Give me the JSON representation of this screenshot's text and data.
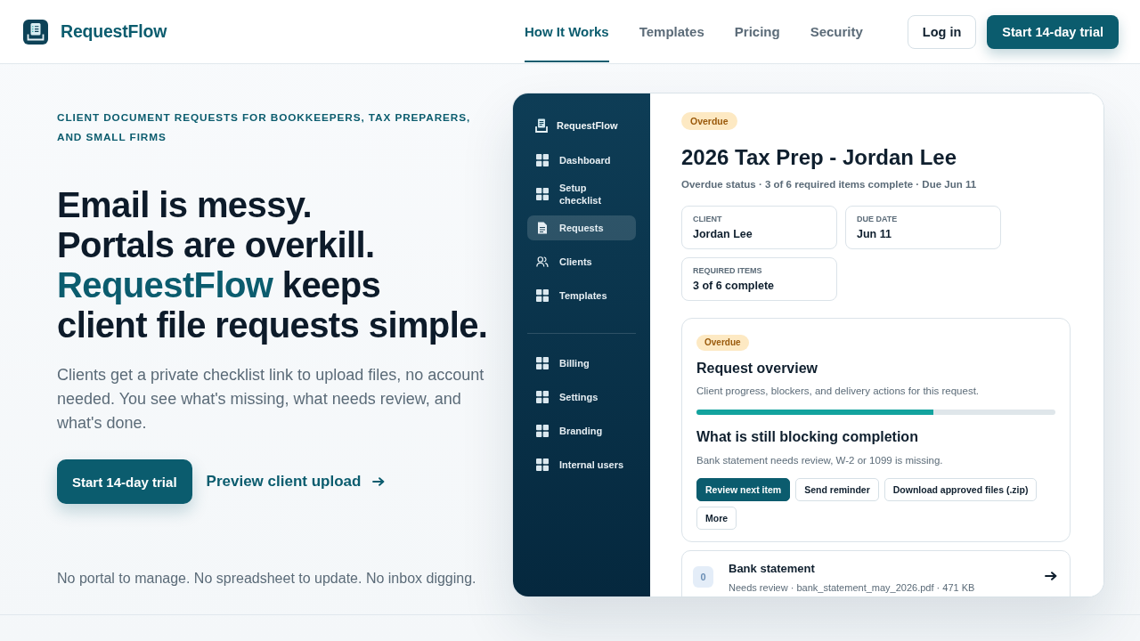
{
  "header": {
    "brand": "RequestFlow",
    "nav": [
      {
        "label": "How It Works",
        "selected": true
      },
      {
        "label": "Templates",
        "selected": false
      },
      {
        "label": "Pricing",
        "selected": false
      },
      {
        "label": "Security",
        "selected": false
      }
    ],
    "login": "Log in",
    "cta": "Start 14-day trial"
  },
  "hero": {
    "eyebrow": "CLIENT DOCUMENT REQUESTS FOR BOOKKEEPERS, TAX PREPARERS, AND SMALL FIRMS",
    "headline": [
      "Email is messy.",
      "Portals are overkill.",
      "**RequestFlow** keeps",
      "client file requests simple."
    ],
    "body": "Clients get a private checklist link to upload files, no account needed. You see what's missing, what needs review, and what's done.",
    "cta": "Start 14-day trial",
    "link": "Preview client upload",
    "note": "No portal to manage. No spreadsheet to update. No inbox digging."
  },
  "app_preview": {
    "sidebar": {
      "brand": "RequestFlow",
      "groups": [
        {
          "items": [
            {
              "label": "Dashboard",
              "kind": "module",
              "selected": false
            },
            {
              "label": "Setup checklist",
              "kind": "module",
              "selected": false
            },
            {
              "label": "Requests",
              "kind": "requests",
              "selected": true
            },
            {
              "label": "Clients",
              "kind": "clients",
              "selected": false
            },
            {
              "label": "Templates",
              "kind": "module",
              "selected": false
            }
          ]
        },
        {
          "items": [
            {
              "label": "Billing",
              "kind": "module",
              "selected": false
            },
            {
              "label": "Settings",
              "kind": "module",
              "selected": false
            },
            {
              "label": "Branding",
              "kind": "module",
              "selected": false
            },
            {
              "label": "Internal users",
              "kind": "module",
              "selected": false
            }
          ]
        }
      ]
    },
    "request": {
      "status": "Overdue",
      "title": "2026 Tax Prep - Jordan Lee",
      "summary": "Overdue status · 3 of 6 required items complete · Due Jun 11",
      "facts": [
        {
          "label": "CLIENT",
          "value": "Jordan Lee"
        },
        {
          "label": "DUE DATE",
          "value": "Jun 11"
        },
        {
          "label": "REQUIRED ITEMS",
          "value": "3 of 6 complete"
        }
      ],
      "overview": {
        "status": "Overdue",
        "title": "Request overview",
        "description": "Client progress, blockers, and delivery actions for this request.",
        "progress": {
          "level": 0.66
        },
        "blocking_title": "What is still blocking completion",
        "blocking_text": "Bank statement needs review, W-2 or 1099 is missing.",
        "actions": [
          {
            "label": "Review next item",
            "kind": "primary"
          },
          {
            "label": "Send reminder",
            "kind": "secondary"
          },
          {
            "label": "Download approved files (.zip)",
            "kind": "secondary"
          },
          {
            "label": "More",
            "kind": "secondary"
          }
        ]
      },
      "items": [
        {
          "count": "0",
          "title": "Bank statement",
          "meta": "Needs review · bank_statement_may_2026.pdf · 471 KB"
        }
      ]
    }
  }
}
